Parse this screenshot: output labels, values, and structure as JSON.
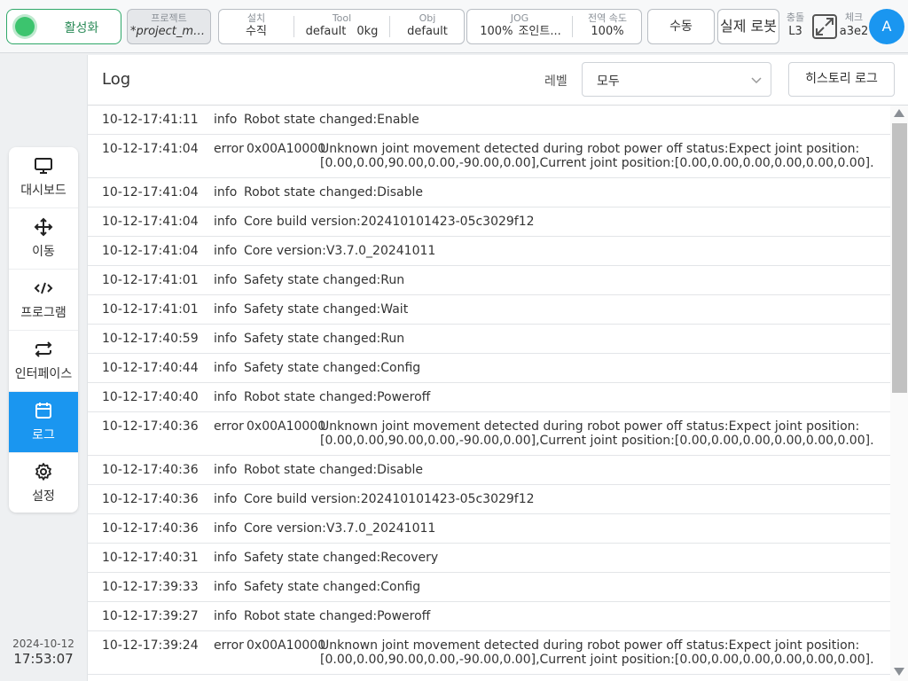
{
  "topbar": {
    "enable_label": "활성화",
    "project": {
      "title": "프로젝트",
      "value": "*project_mo..."
    },
    "install": {
      "title": "설치",
      "value": "수직"
    },
    "tool": {
      "title": "Tool",
      "name": "default",
      "weight": "0kg"
    },
    "obj": {
      "title": "Obj",
      "value": "default"
    },
    "jog": {
      "title": "JOG",
      "percent": "100%",
      "mode": "조인트..."
    },
    "global_speed": {
      "title": "전역 속도",
      "value": "100%"
    },
    "manual_label": "수동",
    "real_robot_label": "실제 로봇",
    "collision": {
      "title": "충돌",
      "value": "L3"
    },
    "check": {
      "title": "체크",
      "value": "a3e2"
    },
    "avatar_letter": "A"
  },
  "sidebar": {
    "items": [
      {
        "label": "대시보드",
        "icon": "monitor-icon",
        "active": false
      },
      {
        "label": "이동",
        "icon": "move-icon",
        "active": false
      },
      {
        "label": "프로그램",
        "icon": "code-icon",
        "active": false
      },
      {
        "label": "인터페이스",
        "icon": "interface-icon",
        "active": false
      },
      {
        "label": "로그",
        "icon": "calendar-icon",
        "active": true
      },
      {
        "label": "설정",
        "icon": "gear-icon",
        "active": false
      }
    ],
    "date": "2024-10-12",
    "time": "17:53:07"
  },
  "log": {
    "title": "Log",
    "level_label": "레벨",
    "level_value": "모두",
    "history_label": "히스토리 로그",
    "rows": [
      {
        "ts": "10-12-17:41:11",
        "level": "info",
        "msg": "Robot state changed:Enable"
      },
      {
        "ts": "10-12-17:41:04",
        "level": "error",
        "code": "0x00A10000",
        "msg": "Unknown joint movement detected during robot power off status:Expect joint position:[0.00,0.00,90.00,0.00,-90.00,0.00],Current joint position:[0.00,0.00,0.00,0.00,0.00,0.00]."
      },
      {
        "ts": "10-12-17:41:04",
        "level": "info",
        "msg": "Robot state changed:Disable"
      },
      {
        "ts": "10-12-17:41:04",
        "level": "info",
        "msg": "Core build version:202410101423-05c3029f12"
      },
      {
        "ts": "10-12-17:41:04",
        "level": "info",
        "msg": "Core version:V3.7.0_20241011"
      },
      {
        "ts": "10-12-17:41:01",
        "level": "info",
        "msg": "Safety state changed:Run"
      },
      {
        "ts": "10-12-17:41:01",
        "level": "info",
        "msg": "Safety state changed:Wait"
      },
      {
        "ts": "10-12-17:40:59",
        "level": "info",
        "msg": "Safety state changed:Run"
      },
      {
        "ts": "10-12-17:40:44",
        "level": "info",
        "msg": "Safety state changed:Config"
      },
      {
        "ts": "10-12-17:40:40",
        "level": "info",
        "msg": "Robot state changed:Poweroff"
      },
      {
        "ts": "10-12-17:40:36",
        "level": "error",
        "code": "0x00A10000",
        "msg": "Unknown joint movement detected during robot power off status:Expect joint position:[0.00,0.00,90.00,0.00,-90.00,0.00],Current joint position:[0.00,0.00,0.00,0.00,0.00,0.00]."
      },
      {
        "ts": "10-12-17:40:36",
        "level": "info",
        "msg": "Robot state changed:Disable"
      },
      {
        "ts": "10-12-17:40:36",
        "level": "info",
        "msg": "Core build version:202410101423-05c3029f12"
      },
      {
        "ts": "10-12-17:40:36",
        "level": "info",
        "msg": "Core version:V3.7.0_20241011"
      },
      {
        "ts": "10-12-17:40:31",
        "level": "info",
        "msg": "Safety state changed:Recovery"
      },
      {
        "ts": "10-12-17:39:33",
        "level": "info",
        "msg": "Safety state changed:Config"
      },
      {
        "ts": "10-12-17:39:27",
        "level": "info",
        "msg": "Robot state changed:Poweroff"
      },
      {
        "ts": "10-12-17:39:24",
        "level": "error",
        "code": "0x00A10000",
        "msg": "Unknown joint movement detected during robot power off status:Expect joint position:[0.00,0.00,90.00,0.00,-90.00,0.00],Current joint position:[0.00,0.00,0.00,0.00,0.00,0.00]."
      }
    ]
  },
  "colors": {
    "accent": "#1a96f0",
    "enable_green": "#3cc46e"
  }
}
